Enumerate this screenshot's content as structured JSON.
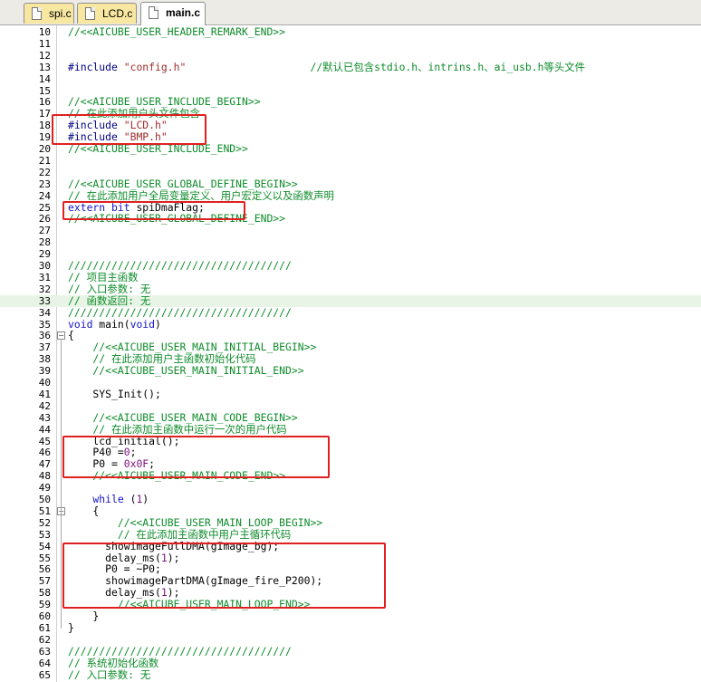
{
  "tabs": [
    {
      "label": "spi.c",
      "active": false
    },
    {
      "label": "LCD.c",
      "active": false
    },
    {
      "label": "main.c",
      "active": true
    }
  ],
  "colors": {
    "highlight": "#e8f5e6",
    "box": "#e02020",
    "tab_inactive": "#f7e7a0"
  },
  "lines": [
    {
      "n": "10",
      "text": "//<<AICUBE_USER_HEADER_REMARK_END>>",
      "color": "c-green"
    },
    {
      "n": "11",
      "text": "",
      "color": "c-black"
    },
    {
      "n": "12",
      "text": "",
      "color": "c-black"
    },
    {
      "n": "13",
      "segments": [
        {
          "t": "#include ",
          "c": "c-navy"
        },
        {
          "t": "\"config.h\"",
          "c": "c-string"
        },
        {
          "t": "                    //默认已包含stdio.h、intrins.h、ai_usb.h等头文件",
          "c": "c-green"
        }
      ]
    },
    {
      "n": "14",
      "text": "",
      "color": "c-black"
    },
    {
      "n": "15",
      "text": "",
      "color": "c-black"
    },
    {
      "n": "16",
      "text": "//<<AICUBE_USER_INCLUDE_BEGIN>>",
      "color": "c-green"
    },
    {
      "n": "17",
      "text": "// 在此添加用户头文件包含",
      "color": "c-green"
    },
    {
      "n": "18",
      "segments": [
        {
          "t": "#include ",
          "c": "c-navy"
        },
        {
          "t": "\"LCD.h\"",
          "c": "c-string"
        }
      ]
    },
    {
      "n": "19",
      "segments": [
        {
          "t": "#include ",
          "c": "c-navy"
        },
        {
          "t": "\"BMP.h\"",
          "c": "c-string"
        }
      ]
    },
    {
      "n": "20",
      "text": "//<<AICUBE_USER_INCLUDE_END>>",
      "color": "c-green"
    },
    {
      "n": "21",
      "text": "",
      "color": "c-black"
    },
    {
      "n": "22",
      "text": "",
      "color": "c-black"
    },
    {
      "n": "23",
      "text": "//<<AICUBE_USER_GLOBAL_DEFINE_BEGIN>>",
      "color": "c-green"
    },
    {
      "n": "24",
      "text": "// 在此添加用户全局变量定义、用户宏定义以及函数声明",
      "color": "c-green"
    },
    {
      "n": "25",
      "segments": [
        {
          "t": "extern bit ",
          "c": "c-blue"
        },
        {
          "t": "spiDmaFlag;",
          "c": "c-black"
        }
      ]
    },
    {
      "n": "26",
      "text": "//<<AICUBE_USER_GLOBAL_DEFINE_END>>",
      "color": "c-green"
    },
    {
      "n": "27",
      "text": "",
      "color": "c-black"
    },
    {
      "n": "28",
      "text": "",
      "color": "c-black"
    },
    {
      "n": "29",
      "text": "",
      "color": "c-black"
    },
    {
      "n": "30",
      "text": "////////////////////////////////////",
      "color": "c-green"
    },
    {
      "n": "31",
      "text": "// 项目主函数",
      "color": "c-green"
    },
    {
      "n": "32",
      "text": "// 入口参数: 无",
      "color": "c-green"
    },
    {
      "n": "33",
      "text": "// 函数返回: 无",
      "color": "c-green",
      "highlight": true
    },
    {
      "n": "34",
      "text": "////////////////////////////////////",
      "color": "c-green"
    },
    {
      "n": "35",
      "segments": [
        {
          "t": "void ",
          "c": "c-blue"
        },
        {
          "t": "main(",
          "c": "c-black"
        },
        {
          "t": "void",
          "c": "c-blue"
        },
        {
          "t": ")",
          "c": "c-black"
        }
      ]
    },
    {
      "n": "36",
      "text": "{",
      "color": "c-black",
      "fold": "−"
    },
    {
      "n": "37",
      "text": "    //<<AICUBE_USER_MAIN_INITIAL_BEGIN>>",
      "color": "c-green"
    },
    {
      "n": "38",
      "text": "    // 在此添加用户主函数初始化代码",
      "color": "c-green"
    },
    {
      "n": "39",
      "text": "    //<<AICUBE_USER_MAIN_INITIAL_END>>",
      "color": "c-green"
    },
    {
      "n": "40",
      "text": "",
      "color": "c-black"
    },
    {
      "n": "41",
      "text": "    SYS_Init();",
      "color": "c-black"
    },
    {
      "n": "42",
      "text": "",
      "color": "c-black"
    },
    {
      "n": "43",
      "text": "    //<<AICUBE_USER_MAIN_CODE_BEGIN>>",
      "color": "c-green"
    },
    {
      "n": "44",
      "text": "    // 在此添加主函数中运行一次的用户代码",
      "color": "c-green"
    },
    {
      "n": "45",
      "text": "    lcd_initial();",
      "color": "c-black"
    },
    {
      "n": "46",
      "segments": [
        {
          "t": "    P40 =",
          "c": "c-black"
        },
        {
          "t": "0",
          "c": "c-purple"
        },
        {
          "t": ";",
          "c": "c-black"
        }
      ]
    },
    {
      "n": "47",
      "segments": [
        {
          "t": "    P0 = ",
          "c": "c-black"
        },
        {
          "t": "0x0F",
          "c": "c-purple"
        },
        {
          "t": ";",
          "c": "c-black"
        }
      ]
    },
    {
      "n": "48",
      "text": "    //<<AICUBE_USER_MAIN_CODE_END>>",
      "color": "c-green"
    },
    {
      "n": "49",
      "text": "",
      "color": "c-black"
    },
    {
      "n": "50",
      "segments": [
        {
          "t": "    while ",
          "c": "c-blue"
        },
        {
          "t": "(",
          "c": "c-black"
        },
        {
          "t": "1",
          "c": "c-purple"
        },
        {
          "t": ")",
          "c": "c-black"
        }
      ]
    },
    {
      "n": "51",
      "text": "    {",
      "color": "c-black",
      "fold": "−"
    },
    {
      "n": "52",
      "text": "        //<<AICUBE_USER_MAIN_LOOP_BEGIN>>",
      "color": "c-green"
    },
    {
      "n": "53",
      "text": "        // 在此添加主函数中用户主循环代码",
      "color": "c-green"
    },
    {
      "n": "54",
      "text": "      showimageFullDMA(gImage_bg);",
      "color": "c-black"
    },
    {
      "n": "55",
      "segments": [
        {
          "t": "      delay_ms(",
          "c": "c-black"
        },
        {
          "t": "1",
          "c": "c-purple"
        },
        {
          "t": ");",
          "c": "c-black"
        }
      ]
    },
    {
      "n": "56",
      "text": "      P0 = ~P0;",
      "color": "c-black"
    },
    {
      "n": "57",
      "text": "      showimagePartDMA(gImage_fire_P200);",
      "color": "c-black"
    },
    {
      "n": "58",
      "segments": [
        {
          "t": "      delay_ms(",
          "c": "c-black"
        },
        {
          "t": "1",
          "c": "c-purple"
        },
        {
          "t": ");",
          "c": "c-black"
        }
      ]
    },
    {
      "n": "59",
      "text": "        //<<AICUBE_USER_MAIN_LOOP_END>>",
      "color": "c-green"
    },
    {
      "n": "60",
      "text": "    }",
      "color": "c-black"
    },
    {
      "n": "61",
      "text": "}",
      "color": "c-black"
    },
    {
      "n": "62",
      "text": "",
      "color": "c-black"
    },
    {
      "n": "63",
      "text": "////////////////////////////////////",
      "color": "c-green"
    },
    {
      "n": "64",
      "text": "// 系统初始化函数",
      "color": "c-green"
    },
    {
      "n": "65",
      "text": "// 入口参数: 无",
      "color": "c-green"
    }
  ]
}
